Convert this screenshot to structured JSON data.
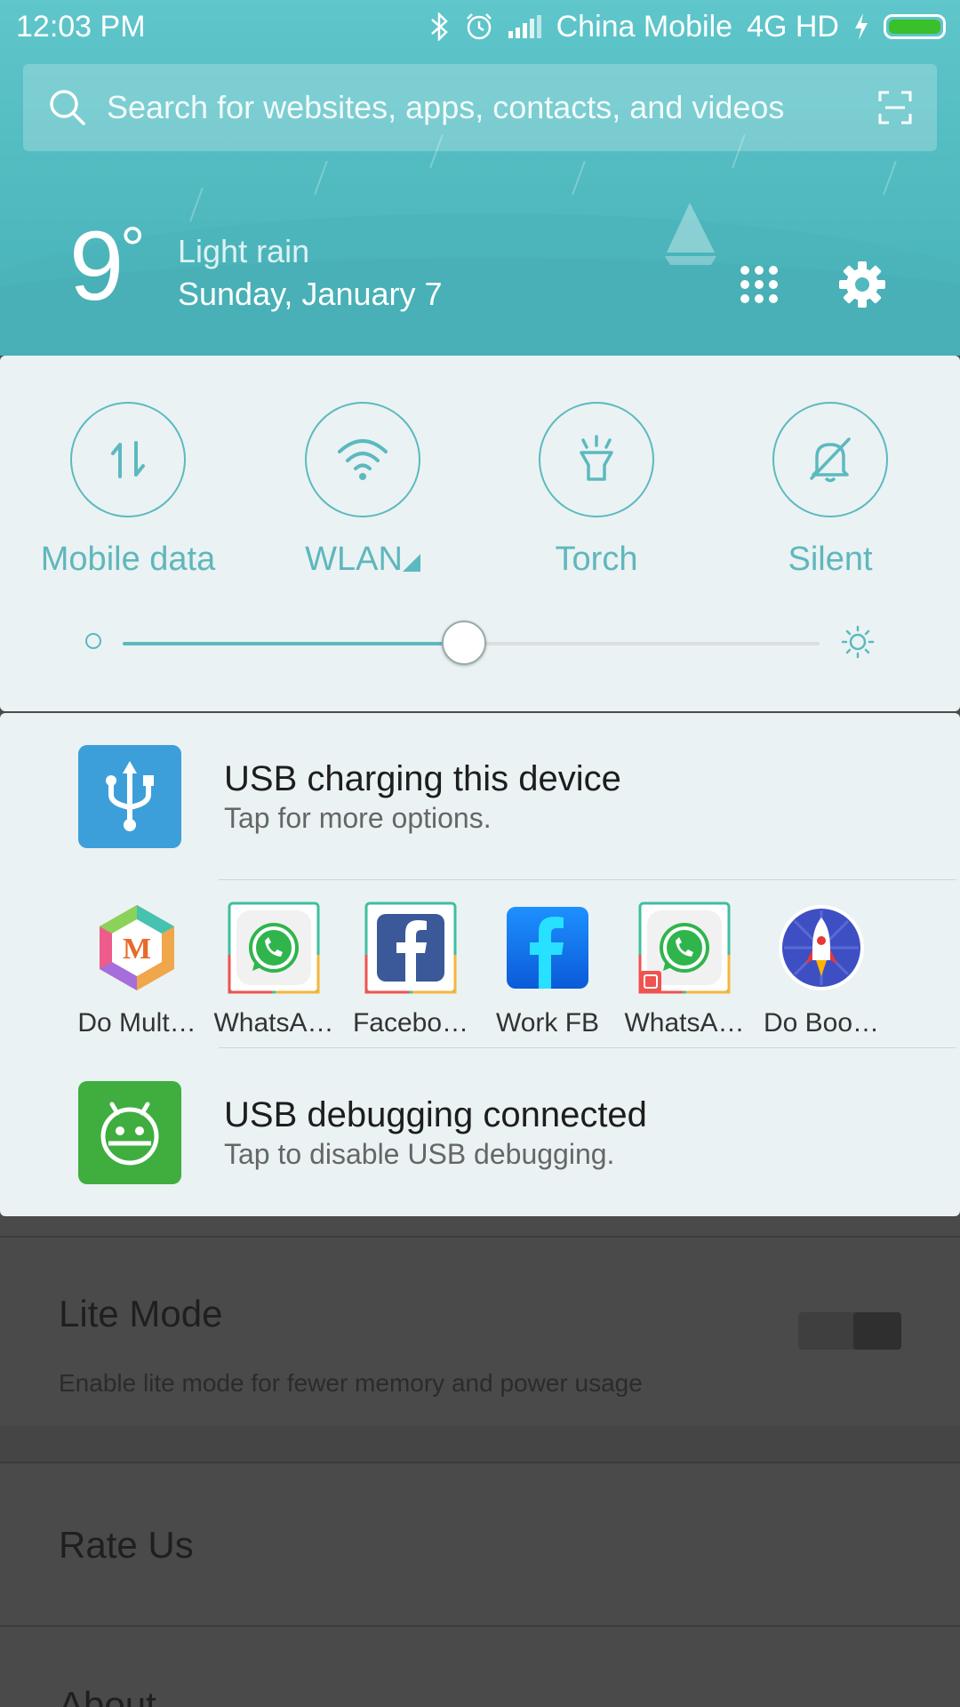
{
  "status_bar": {
    "time": "12:03 PM",
    "carrier": "China Mobile",
    "network": "4G HD",
    "battery_level": 1.0,
    "battery_color": "#3ac02a",
    "icons": [
      "bluetooth-icon",
      "alarm-icon",
      "signal-icon",
      "charging-icon",
      "battery-icon"
    ]
  },
  "search": {
    "placeholder": "Search for websites, apps, contacts, and videos"
  },
  "weather": {
    "temperature": "9",
    "degree_symbol": "°",
    "condition": "Light rain",
    "date": "Sunday, January 7"
  },
  "quick_toggles": [
    {
      "label": "Mobile data",
      "icon": "mobile-data-icon"
    },
    {
      "label": "WLAN",
      "icon": "wifi-icon"
    },
    {
      "label": "Torch",
      "icon": "torch-icon"
    },
    {
      "label": "Silent",
      "icon": "silent-bell-icon"
    }
  ],
  "brightness": {
    "level": 0.49
  },
  "notifications": {
    "usb_charging": {
      "title": "USB charging this device",
      "subtitle": "Tap for more options.",
      "color": "#3d9fd9"
    },
    "apps": [
      {
        "label": "Do Mult…",
        "icon": "do-multiple-accounts-icon"
      },
      {
        "label": "WhatsA…",
        "icon": "whatsapp-icon"
      },
      {
        "label": "Facebo…",
        "icon": "facebook-icon"
      },
      {
        "label": "Work FB",
        "icon": "work-fb-icon"
      },
      {
        "label": "WhatsA…",
        "icon": "whatsapp-clone-icon"
      },
      {
        "label": "Do Boo…",
        "icon": "do-booster-icon"
      }
    ],
    "usb_debugging": {
      "title": "USB debugging connected",
      "subtitle": "Tap to disable USB debugging.",
      "color": "#3fae3f"
    }
  },
  "background_settings": {
    "lite_mode": {
      "title": "Lite Mode",
      "description": "Enable lite mode for fewer memory and power usage"
    },
    "rate_us": "Rate Us",
    "about": "About"
  },
  "colors": {
    "accent": "#5cb9bf",
    "panel": "#eaf2f3",
    "header": "#4fb9bf"
  }
}
